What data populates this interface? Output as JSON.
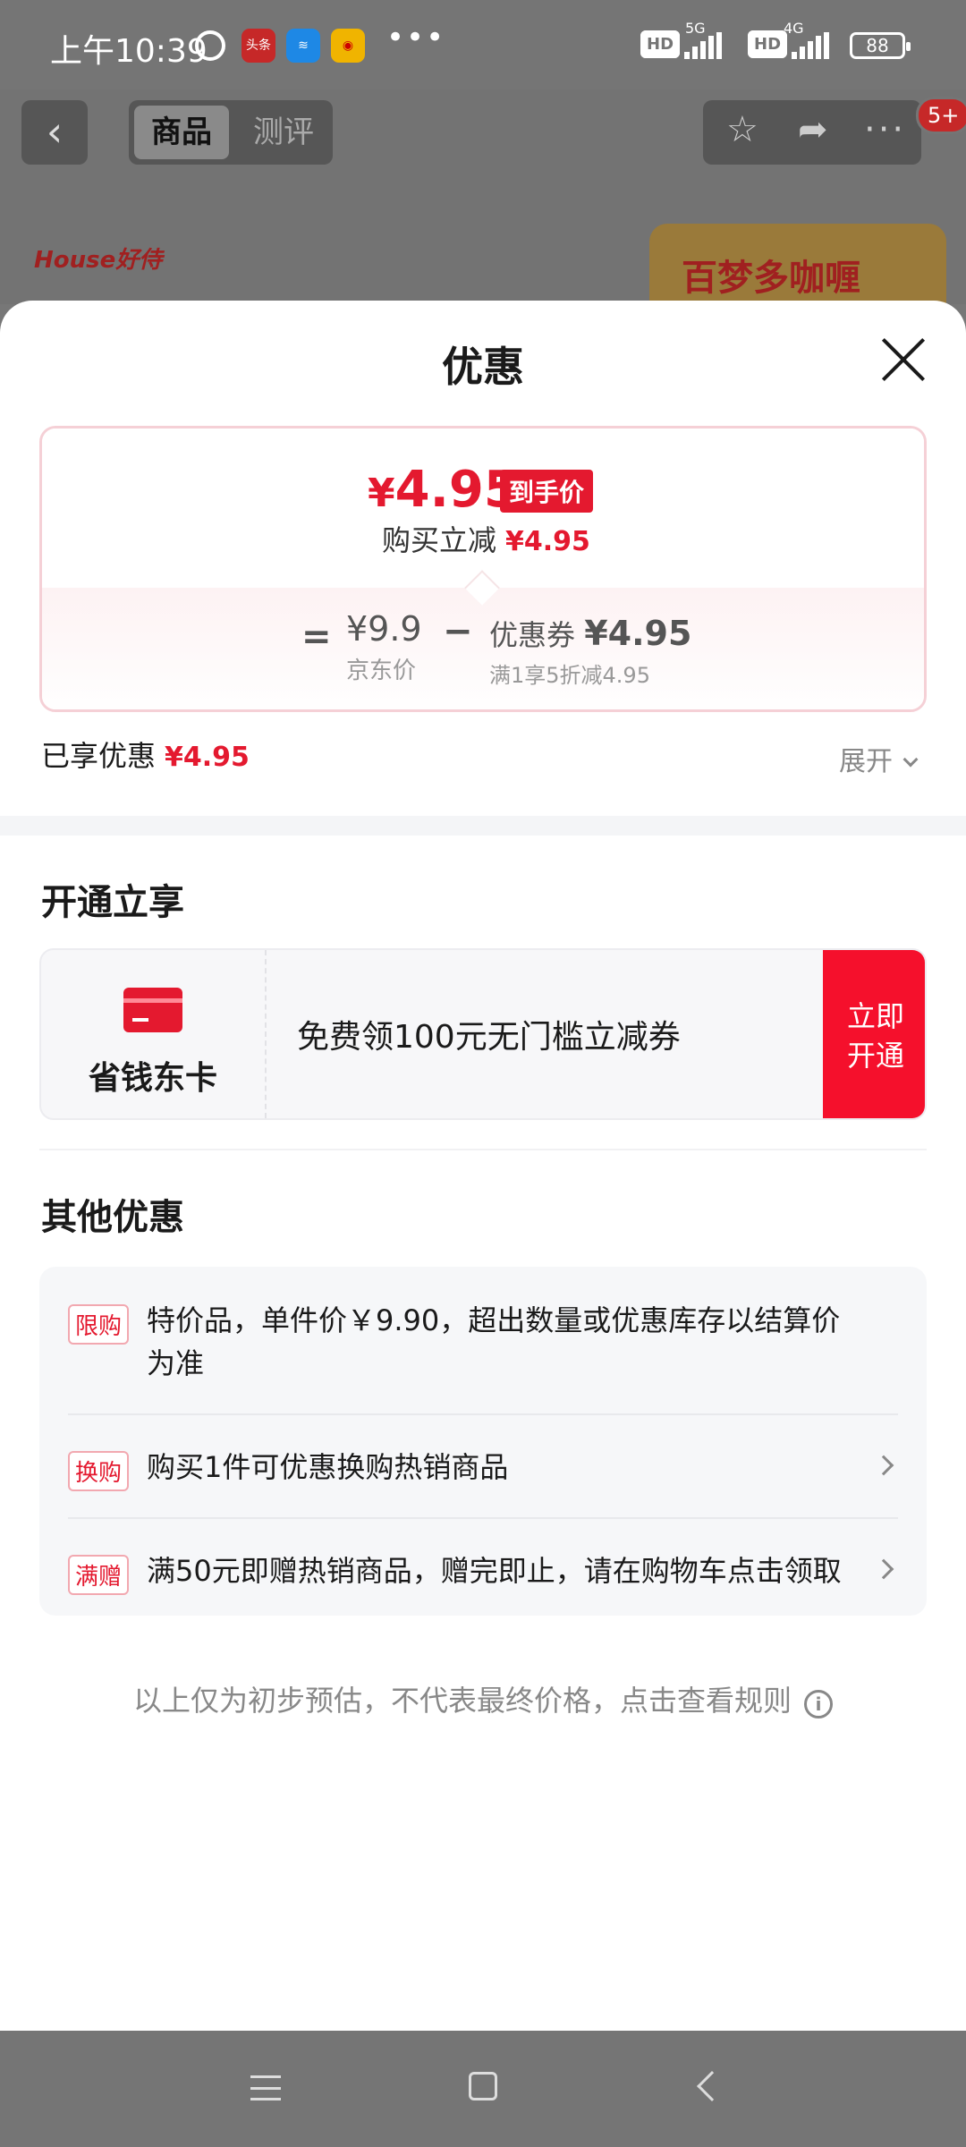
{
  "status_bar": {
    "time": "上午10:39",
    "app_icons": [
      "头条",
      "≋",
      "◉"
    ],
    "more": "•••",
    "network1": "5G",
    "network2": "4G",
    "hd": "HD",
    "battery": "88"
  },
  "top_nav": {
    "back_icon": "chevron-left-icon",
    "tabs": [
      "商品",
      "测评"
    ],
    "actions": [
      "star-icon",
      "share-icon",
      "more-icon"
    ],
    "message_badge": "5+",
    "brand_logo_text": "House好侍",
    "product_thumb_text": "百梦多咖喱"
  },
  "sheet": {
    "title": "优惠",
    "price_card": {
      "final_currency": "¥",
      "final_price": "4.95",
      "final_tag": "到手价",
      "buy_cut_label": "购买立减",
      "buy_cut_value": "¥4.95",
      "equals": "=",
      "jd_price": "¥9.9",
      "jd_label": "京东价",
      "minus": "−",
      "coupon_label": "优惠券",
      "coupon_value": "¥4.95",
      "coupon_desc": "满1享5折减4.95"
    },
    "enjoyed_label": "已享优惠",
    "enjoyed_value": "¥4.95",
    "expand_label": "展开",
    "open_section_title": "开通立享",
    "vip": {
      "name": "省钱东卡",
      "offer": "免费领100元无门槛立减券",
      "button_line1": "立即",
      "button_line2": "开通"
    },
    "other_section_title": "其他优惠",
    "other_rows": [
      {
        "tag": "限购",
        "text_line1": "特价品，单件价￥9.90，超出数量或优惠库存以结算价",
        "text_line2": "为准"
      },
      {
        "tag": "换购",
        "text": "购买1件可优惠换购热销商品"
      },
      {
        "tag": "满赠",
        "text": "满50元即赠热销商品，赠完即止，请在购物车点击领取"
      }
    ],
    "disclaimer": "以上仅为初步预估，不代表最终价格，点击查看规则",
    "info_icon": "i"
  },
  "colors": {
    "accent": "#e4192f",
    "dim_overlay": "#757575"
  }
}
